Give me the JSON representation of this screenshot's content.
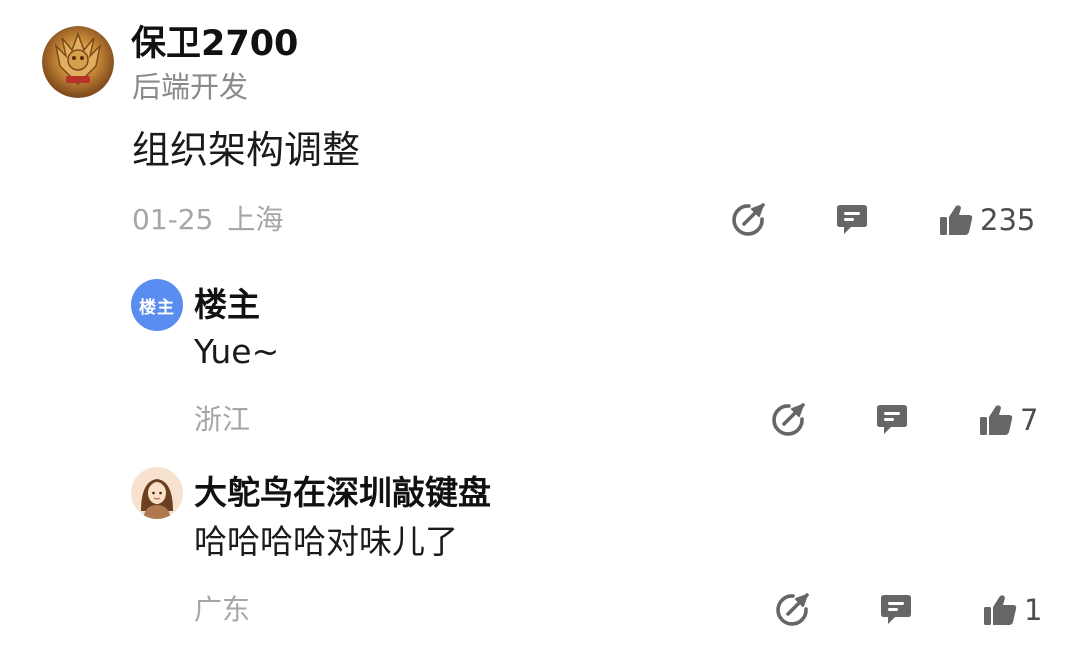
{
  "main_comment": {
    "author": "保卫2700",
    "subtitle": "后端开发",
    "content": "组织架构调整",
    "date": "01-25",
    "location": "上海",
    "like_count": "235"
  },
  "replies": [
    {
      "avatar_text": "楼主",
      "author": "楼主",
      "content": "Yue~",
      "location": "浙江",
      "like_count": "7"
    },
    {
      "author": "大鸵鸟在深圳敲键盘",
      "content": "哈哈哈哈对味儿了",
      "location": "广东",
      "like_count": "1"
    }
  ],
  "icons": {
    "share": "share-icon",
    "comment": "comment-icon",
    "like": "thumbs-up-icon"
  },
  "colors": {
    "lz_badge": "#5b8cf0",
    "icon_gray": "#666666",
    "meta_gray": "#a6a6a6"
  }
}
